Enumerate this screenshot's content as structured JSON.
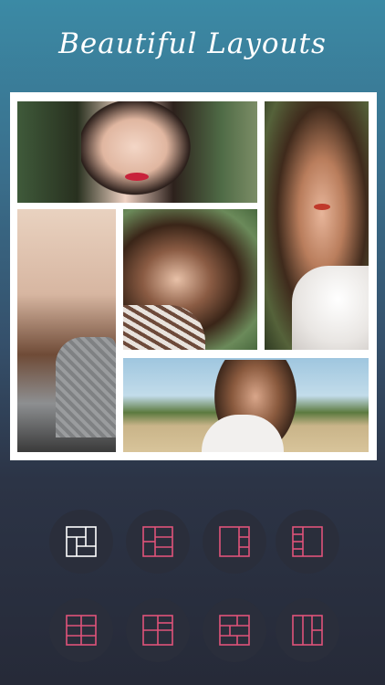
{
  "header": {
    "title": "Beautiful Layouts"
  },
  "collage": {
    "photos": [
      "portrait-hands-face",
      "portrait-outdoor-long-hair",
      "portrait-laughing-sweater",
      "portrait-curly-hair-smile",
      "portrait-field-curly-hair"
    ]
  },
  "layouts": {
    "accent_color": "#e0537a",
    "selected_color": "#ffffff",
    "buttons": [
      {
        "icon": "layout-pinwheel-icon",
        "selected": true
      },
      {
        "icon": "layout-left-tall-three-right-icon",
        "selected": false
      },
      {
        "icon": "layout-left-tall-three-right-alt-icon",
        "selected": false
      },
      {
        "icon": "layout-two-column-four-right-icon",
        "selected": false
      },
      {
        "icon": "layout-grid-2x3-icon",
        "selected": false
      },
      {
        "icon": "layout-two-by-two-plus-icon",
        "selected": false
      },
      {
        "icon": "layout-bricks-icon",
        "selected": false
      },
      {
        "icon": "layout-column-split-icon",
        "selected": false
      }
    ]
  }
}
